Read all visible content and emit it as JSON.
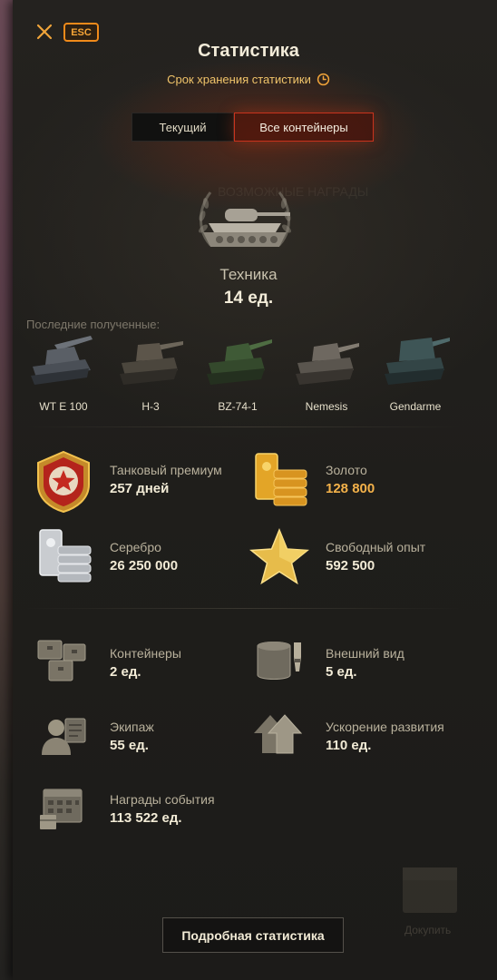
{
  "header": {
    "title": "Статистика",
    "esc_label": "ESC",
    "subtitle": "Срок хранения статистики"
  },
  "tabs": [
    {
      "label": "Текущий",
      "active": false
    },
    {
      "label": "Все контейнеры",
      "active": true
    }
  ],
  "background_ghost": {
    "rewards_text": "ВОЗМОЖНЫЕ НАГРАДЫ",
    "buy_text": "Докупить"
  },
  "tech": {
    "label": "Техника",
    "count": "14 ед."
  },
  "recent": {
    "label": "Последние полученные:",
    "vehicles": [
      {
        "name": "WT E 100",
        "color": "#5a5f66"
      },
      {
        "name": "Н-3",
        "color": "#5c554a"
      },
      {
        "name": "BZ-74-1",
        "color": "#3f5a36"
      },
      {
        "name": "Nemesis",
        "color": "#6e6860"
      },
      {
        "name": "Gendarme",
        "color": "#3e5556"
      }
    ]
  },
  "resources": [
    {
      "label": "Танковый премиум",
      "value": "257 дней",
      "icon": "premium-tank-badge-icon"
    },
    {
      "label": "Золото",
      "value": "128 800",
      "icon": "gold-bars-icon",
      "accent": "#f4b24a"
    },
    {
      "label": "Серебро",
      "value": "26 250 000",
      "icon": "silver-bars-icon"
    },
    {
      "label": "Свободный опыт",
      "value": "592 500",
      "icon": "free-xp-star-icon"
    }
  ],
  "items": [
    {
      "label": "Контейнеры",
      "value": "2 ед.",
      "icon": "containers-icon"
    },
    {
      "label": "Внешний вид",
      "value": "5 ед.",
      "icon": "customization-brush-icon"
    },
    {
      "label": "Экипаж",
      "value": "55 ед.",
      "icon": "crew-icon"
    },
    {
      "label": "Ускорение развития",
      "value": "110 ед.",
      "icon": "boosters-arrow-icon"
    },
    {
      "label": "Награды события",
      "value": "113 522 ед.",
      "icon": "event-rewards-calendar-icon"
    }
  ],
  "footer": {
    "details_button": "Подробная статистика"
  },
  "colors": {
    "accent_orange": "#f08a1a",
    "active_tab_border": "#c9331d",
    "gold_text": "#f4b24a"
  }
}
